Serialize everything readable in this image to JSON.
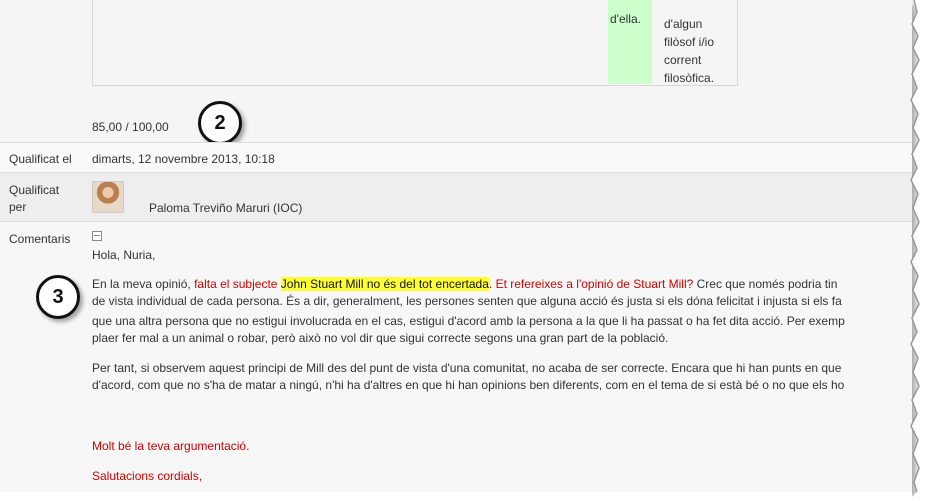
{
  "rubric": {
    "green_cell": "d'ella.",
    "criterion_lines": [
      "d'algun",
      "filòsof i/io",
      "corrent",
      "filosòfica."
    ]
  },
  "grade": {
    "value": "85,00 / 100,00"
  },
  "annotations": {
    "first": "2",
    "second": "3"
  },
  "graded_on": {
    "label": "Qualificat el",
    "value": "dimarts, 12 novembre 2013, 10:18"
  },
  "graded_by": {
    "label_line1": "Qualificat",
    "label_line2": "per",
    "name": "Paloma Treviño Maruri (IOC)"
  },
  "comments": {
    "label": "Comentaris",
    "greeting": "Hola, Nuria,",
    "p1_line1_start": "En la meva opinió, ",
    "p1_line1_red": "falta el subjecte ",
    "p1_line1_hl": "John Stuart Mill no és del tot encertada",
    "p1_line1_red2": ". Et refereixes a l'opinió de Stuart Mill?",
    "p1_line1_end": " Crec que només podria tin",
    "p1_line2": "de vista individual de cada persona. És a dir, generalment, les persones senten que alguna acció és justa si els dóna felicitat i injusta si els fa",
    "p1_line3": "que una altra persona que no estigui involucrada en el cas, estigui d'acord amb la persona a la que li ha passat o ha fet dita acció. Per exemp",
    "p1_line4": "plaer fer mal a un animal o robar, però això no vol dir que sigui correcte segons una gran part de la població.",
    "p2_line1": "Per tant, si observem aquest principi de Mill des del punt de vista d'una comunitat, no acaba de ser correcte. Encara que hi han punts en que",
    "p2_line2": "d'acord, com que no s'ha de matar a ningú, n'hi ha d'altres en que hi han opinions ben diferents, com en el tema de si està bé o no que els ho",
    "closing1": "Molt bé la teva argumentació.",
    "closing2": "Salutacions cordials,"
  },
  "colors": {
    "red": "#d40000",
    "highlight": "#ffff33",
    "green": "#ccffcc"
  }
}
